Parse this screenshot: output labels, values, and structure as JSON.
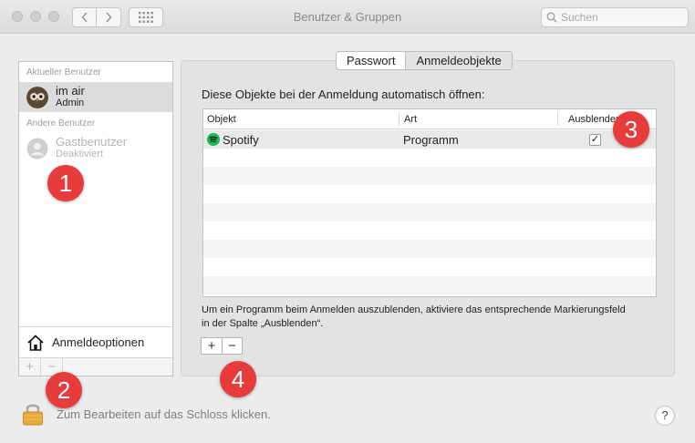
{
  "window": {
    "title": "Benutzer & Gruppen"
  },
  "search": {
    "placeholder": "Suchen"
  },
  "sidebar": {
    "current_user_header": "Aktueller Benutzer",
    "current_user": {
      "name": "im air",
      "role": "Admin"
    },
    "other_users_header": "Andere Benutzer",
    "other_users": [
      {
        "name": "Gastbenutzer",
        "status": "Deaktiviert"
      }
    ],
    "login_options_label": "Anmeldeoptionen",
    "add_label": "+",
    "remove_label": "−"
  },
  "tabs": [
    {
      "label": "Passwort",
      "active": false
    },
    {
      "label": "Anmeldeobjekte",
      "active": true
    }
  ],
  "login_items": {
    "heading": "Diese Objekte bei der Anmeldung automatisch öffnen:",
    "columns": [
      "Objekt",
      "Art",
      "Ausblenden"
    ],
    "rows": [
      {
        "object": "Spotify",
        "kind": "Programm",
        "hide": true,
        "hide_mark": "✓"
      }
    ],
    "hint": "Um ein Programm beim Anmelden auszublenden, aktiviere das entsprechende Markierungsfeld in der Spalte „Ausblenden“.",
    "add_label": "+",
    "remove_label": "−"
  },
  "lock": {
    "text": "Zum Bearbeiten auf das Schloss klicken."
  },
  "help": {
    "label": "?"
  },
  "markers": [
    "1",
    "2",
    "3",
    "4"
  ],
  "colors": {
    "marker": "#e83b3b",
    "spotify": "#1db954",
    "selection": "#dcdcdc"
  }
}
